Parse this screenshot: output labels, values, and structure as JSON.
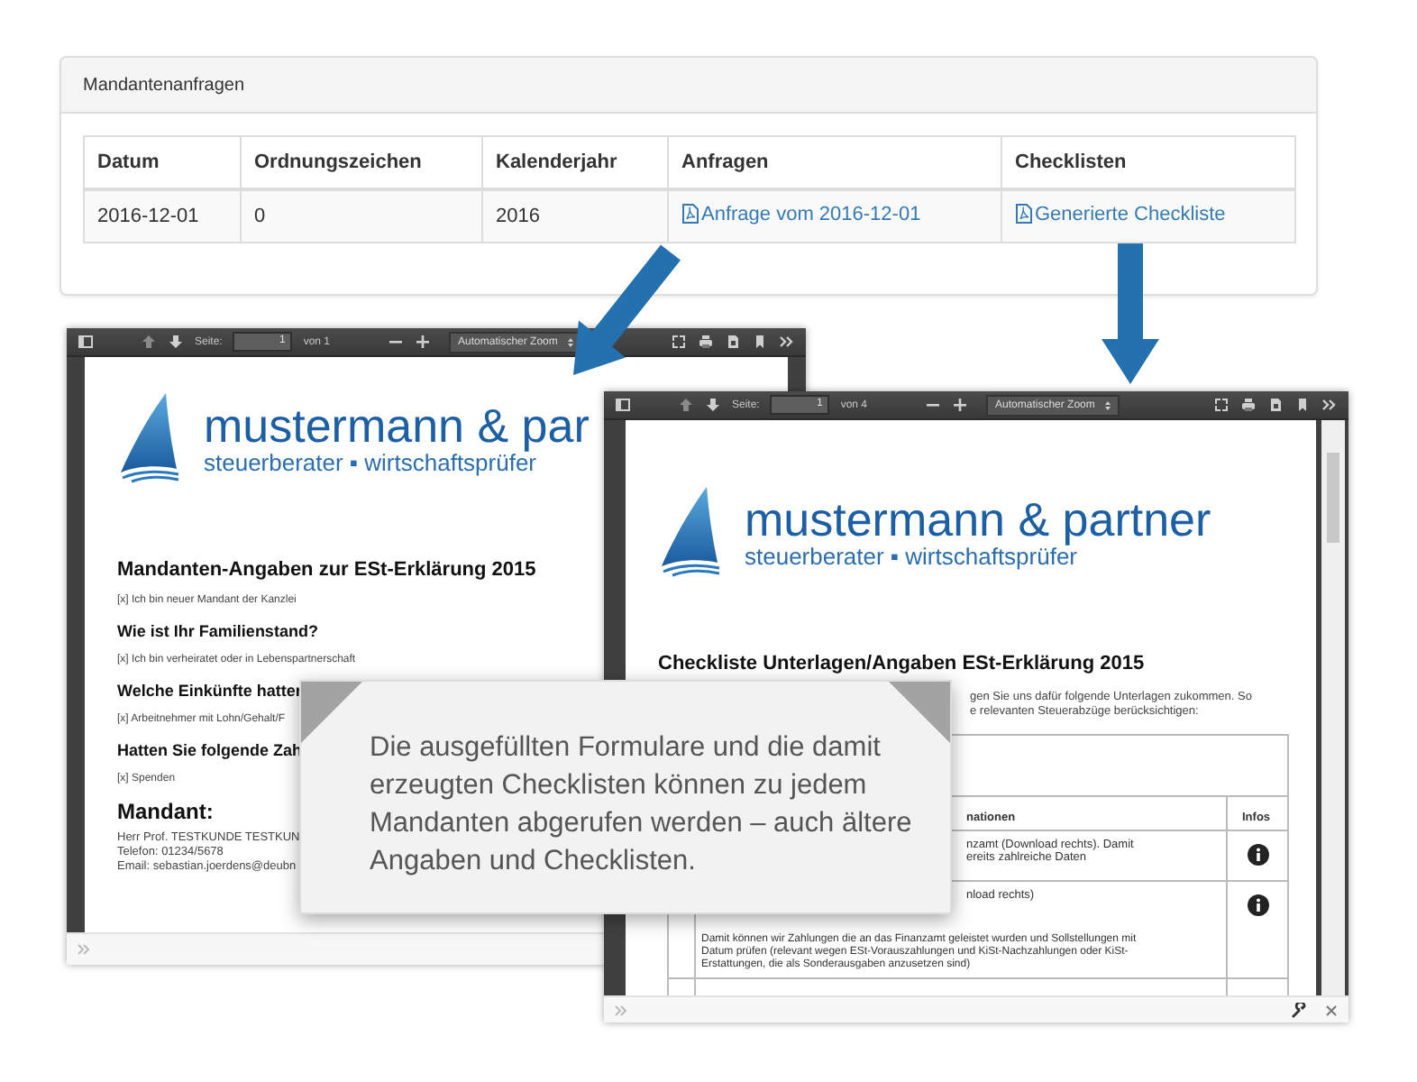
{
  "panel": {
    "title": "Mandantenanfragen",
    "table": {
      "columns": [
        "Datum",
        "Ordnungszeichen",
        "Kalenderjahr",
        "Anfragen",
        "Checklisten"
      ],
      "rows": [
        {
          "cells": [
            {
              "kind": "text",
              "text": "2016-12-01"
            },
            {
              "kind": "text",
              "text": "0"
            },
            {
              "kind": "text",
              "text": "2016"
            },
            {
              "kind": "link",
              "text": "Anfrage vom 2016-12-01"
            },
            {
              "kind": "link",
              "text": "Generierte Checkliste"
            }
          ]
        }
      ]
    }
  },
  "form_viewer": {
    "toolbar": {
      "page_label": "Seite:",
      "page_value": "1",
      "page_count": "von 1",
      "zoom": "Automatischer Zoom"
    },
    "document": [
      {
        "kind": "logo",
        "name": "mustermann & par",
        "tagline": "steuerberater ▪ wirtschaftsprüfer"
      },
      {
        "kind": "title",
        "text": "Mandanten-Angaben zur ESt-Erklärung 2015"
      },
      {
        "kind": "note",
        "text": "[x] Ich bin neuer Mandant der Kanzlei"
      },
      {
        "kind": "question",
        "text": "Wie ist Ihr Familienstand?"
      },
      {
        "kind": "note",
        "text": "[x] Ich bin verheiratet oder in Lebenspartnerschaft"
      },
      {
        "kind": "question",
        "text": "Welche Einkünfte hatter"
      },
      {
        "kind": "note",
        "text": "[x] Arbeitnehmer mit Lohn/Gehalt/F"
      },
      {
        "kind": "question",
        "text": "Hatten Sie folgende Zah"
      },
      {
        "kind": "note",
        "text": "[x] Spenden"
      },
      {
        "kind": "heading",
        "text": "Mandant:"
      },
      {
        "kind": "contact",
        "text": "Herr Prof. TESTKUNDE TESTKUN"
      },
      {
        "kind": "contact",
        "text": "Telefon: 01234/5678"
      },
      {
        "kind": "contact",
        "text": "Email: sebastian.joerdens@deubn"
      }
    ]
  },
  "checklist_viewer": {
    "toolbar": {
      "page_label": "Seite:",
      "page_value": "1",
      "page_count": "von 4",
      "zoom": "Automatischer Zoom"
    },
    "bottom_tools": true,
    "document": [
      {
        "kind": "logo",
        "name": "mustermann & partner",
        "tagline": "steuerberater ▪ wirtschaftsprüfer"
      },
      {
        "kind": "title",
        "text": "Checkliste Unterlagen/Angaben ESt-Erklärung 2015"
      },
      {
        "kind": "intro",
        "lines": [
          "gen Sie uns dafür folgende Unterlagen zukommen. So",
          "e relevanten Steuerabzüge berücksichtigen:"
        ]
      },
      {
        "kind": "table",
        "columns": [
          "nationen",
          "Infos"
        ],
        "rows": [
          {
            "lines": [
              "nzamt (Download rechts). Damit",
              "ereits zahlreiche Daten"
            ],
            "info": true
          },
          {
            "lines": [
              "nload rechts)"
            ],
            "detail": "Damit können wir Zahlungen die an das Finanzamt geleistet wurden und Sollstellungen mit Datum prüfen (relevant wegen ESt-Vorauszahlungen und KiSt-Nachzahlungen oder KiSt-Erstattungen, die als Sonderausgaben anzusetzen sind)",
            "info": true
          }
        ]
      }
    ]
  },
  "callout": {
    "text": "Die ausgefüllten Formulare und die damit erzeugten Checklisten können zu jedem Mandanten abgerufen werden – auch ältere Angaben und Checklisten."
  }
}
